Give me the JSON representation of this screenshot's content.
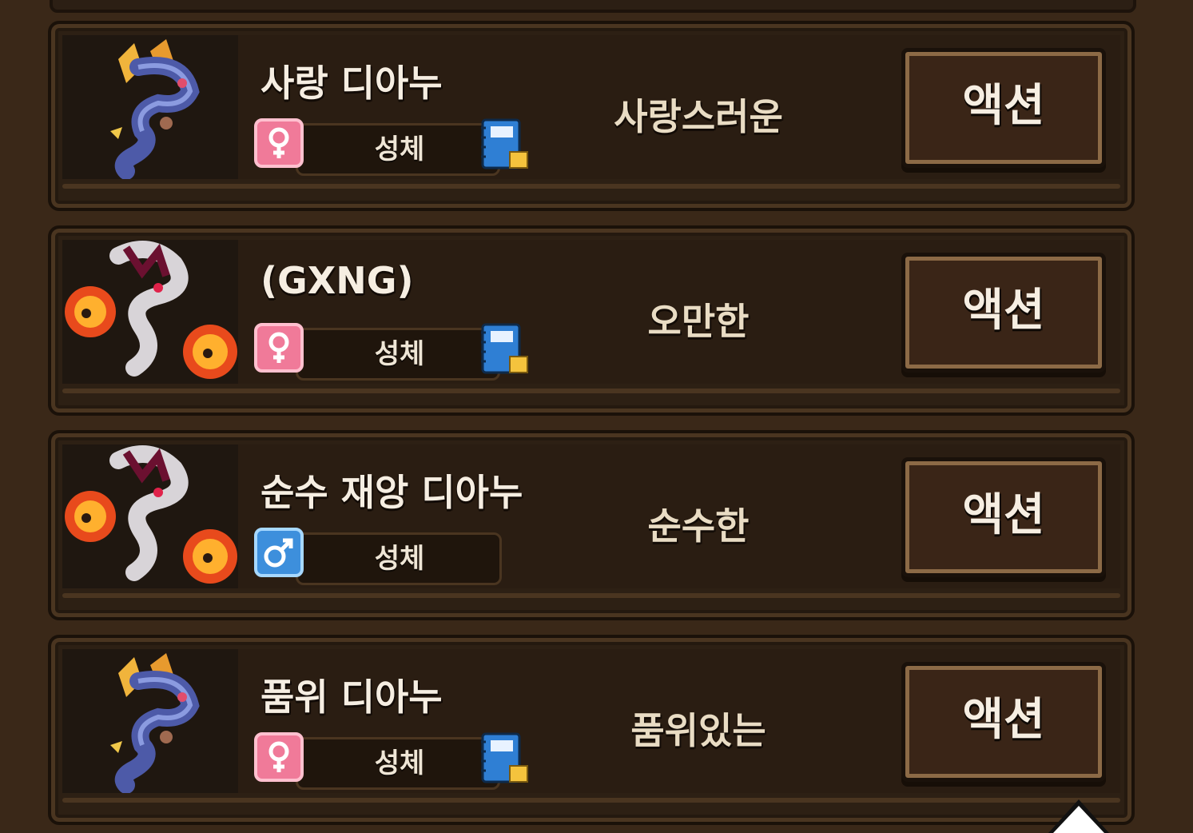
{
  "roster": {
    "items": [
      {
        "name": "사랑 디아누",
        "portrait_icon": "blue-serpent-dragon-icon",
        "gender": "female",
        "gender_icon": "female-symbol-icon",
        "stage": "성체",
        "has_notebook": true,
        "notebook_icon": "notebook-icon",
        "trait": "사랑스러운",
        "action_label": "액션"
      },
      {
        "name": "(GXNG)",
        "portrait_icon": "calamity-serpent-dragon-icon",
        "gender": "female",
        "gender_icon": "female-symbol-icon",
        "stage": "성체",
        "has_notebook": true,
        "notebook_icon": "notebook-icon",
        "trait": "오만한",
        "action_label": "액션"
      },
      {
        "name": "순수 재앙 디아누",
        "portrait_icon": "calamity-serpent-dragon-icon",
        "gender": "male",
        "gender_icon": "male-symbol-icon",
        "stage": "성체",
        "has_notebook": false,
        "trait": "순수한",
        "action_label": "액션"
      },
      {
        "name": "품위 디아누",
        "portrait_icon": "blue-serpent-dragon-icon",
        "gender": "female",
        "gender_icon": "female-symbol-icon",
        "stage": "성체",
        "has_notebook": true,
        "notebook_icon": "notebook-icon",
        "trait": "품위있는",
        "action_label": "액션"
      }
    ]
  },
  "scroll": {
    "icon": "scroll-up-arrow-icon"
  },
  "colors": {
    "background": "#3a2818",
    "card": "#2d2014",
    "female": "#f07a99",
    "male": "#3d8fdc",
    "notebook": "#2f7fd4",
    "action_button": "#3a2517"
  }
}
